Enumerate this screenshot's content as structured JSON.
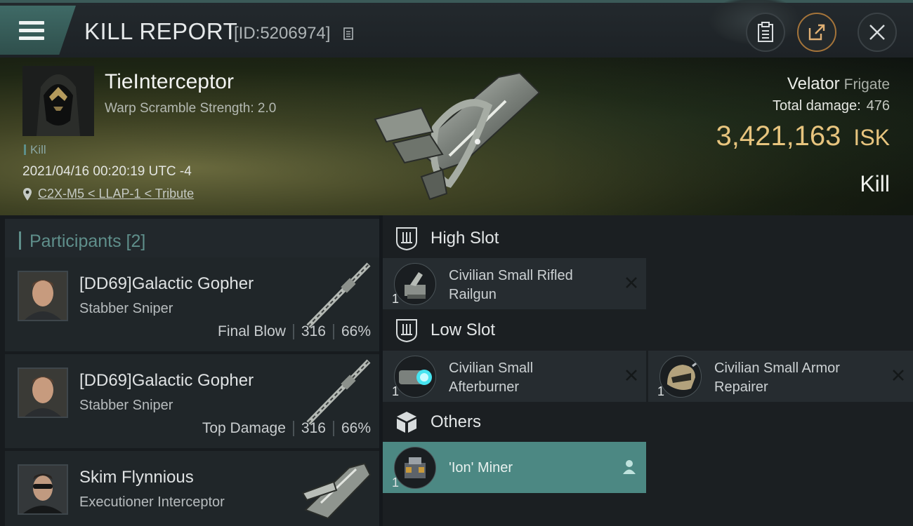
{
  "header": {
    "title": "KILL REPORT",
    "report_id": "[ID:5206974]",
    "icons": [
      "menu-icon",
      "copy-icon",
      "clipboard-icon",
      "share-icon",
      "close-icon"
    ]
  },
  "victim": {
    "name": "TieInterceptor",
    "subtitle": "Warp Scramble Strength: 2.0",
    "tag": "Kill",
    "timestamp": "2021/04/16 00:20:19 UTC -4",
    "location": "C2X-M5 < LLAP-1 < Tribute",
    "ship_name": "Velator",
    "ship_class": "Frigate",
    "total_damage_label": "Total damage:",
    "total_damage": "476",
    "isk_value": "3,421,163",
    "isk_unit": "ISK",
    "result": "Kill"
  },
  "participants": {
    "title": "Participants [2]",
    "rows": [
      {
        "name": "[DD69]Galactic Gopher",
        "ship": "Stabber Sniper",
        "label": "Final Blow",
        "damage": "316",
        "percent": "66%"
      },
      {
        "name": "[DD69]Galactic Gopher",
        "ship": "Stabber Sniper",
        "label": "Top Damage",
        "damage": "316",
        "percent": "66%"
      },
      {
        "name": "Skim Flynnious",
        "ship": "Executioner Interceptor"
      }
    ]
  },
  "slots": {
    "high": {
      "title": "High Slot",
      "items": [
        {
          "name": "Civilian Small Rifled Railgun",
          "qty": "1"
        }
      ]
    },
    "low": {
      "title": "Low Slot",
      "items": [
        {
          "name": "Civilian Small Afterburner",
          "qty": "1"
        },
        {
          "name": "Civilian Small Armor Repairer",
          "qty": "1"
        }
      ]
    },
    "others": {
      "title": "Others",
      "items": [
        {
          "name": "'Ion' Miner",
          "qty": "1"
        }
      ]
    }
  },
  "colors": {
    "accent_teal": "#4c8883",
    "isk_gold": "#e7c47e",
    "panel_dark": "#202629"
  }
}
